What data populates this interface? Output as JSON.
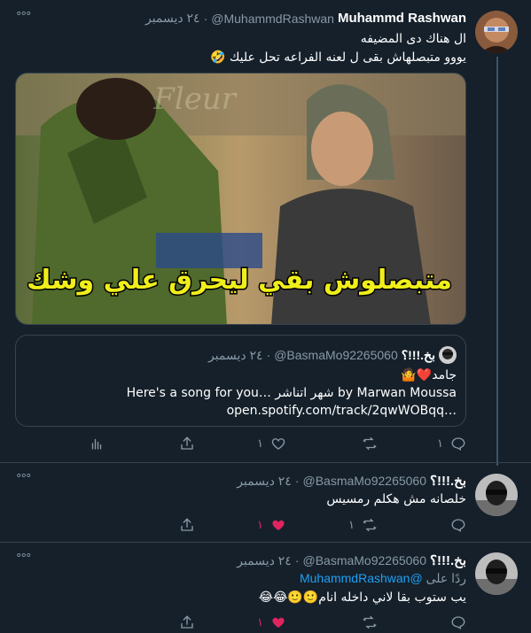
{
  "tweets": [
    {
      "name": "Muhammd Rashwan",
      "handle": "@MuhammdRashwan",
      "separator": "·",
      "date": "٢٤ ديسمبر",
      "more": "°°°",
      "lines": [
        "ال هناك دى المضيفه",
        "يووو متبصلهاش بقى ل لعنه الفراعه تحل عليك 🤣"
      ],
      "image_caption": "متبصلوش بقي ليحرق علي وشك",
      "image_watermark": "Fleur",
      "quote": {
        "name": "بخ.!!!؟",
        "handle": "@BasmaMo92265060",
        "separator": "·",
        "date": "٢٤ ديسمبر",
        "lines": [
          "جامد❤️🤷",
          "by Marwan Moussa شهر اتناشر …Here's a song for you",
          "open.spotify.com/track/2qwWOBqq…"
        ]
      },
      "actions": {
        "reply": "١",
        "retweet": "",
        "like": "١",
        "share": "",
        "stats": ""
      }
    },
    {
      "name": "بخ.!!!؟",
      "handle": "@BasmaMo92265060",
      "separator": "·",
      "date": "٢٤ ديسمبر",
      "more": "°°°",
      "lines": [
        "خلصانه مش هكلم رمسيس"
      ],
      "actions": {
        "reply": "",
        "retweet": "١",
        "like": "١",
        "share": ""
      }
    },
    {
      "name": "بخ.!!!؟",
      "handle": "@BasmaMo92265060",
      "separator": "·",
      "date": "٢٤ ديسمبر",
      "more": "°°°",
      "reply_prefix": "ردًا على",
      "reply_mention": "@MuhammdRashwan",
      "lines": [
        "يب ستوب بقا لاني داخله انام🙂🙂😂😂"
      ],
      "actions": {
        "reply": "",
        "retweet": "",
        "like": "١",
        "share": ""
      }
    }
  ],
  "colors": {
    "background": "#15202b",
    "border": "#38444d",
    "secondary_text": "#8899a6",
    "link": "#1da1f2",
    "like_active": "#e0245e"
  }
}
